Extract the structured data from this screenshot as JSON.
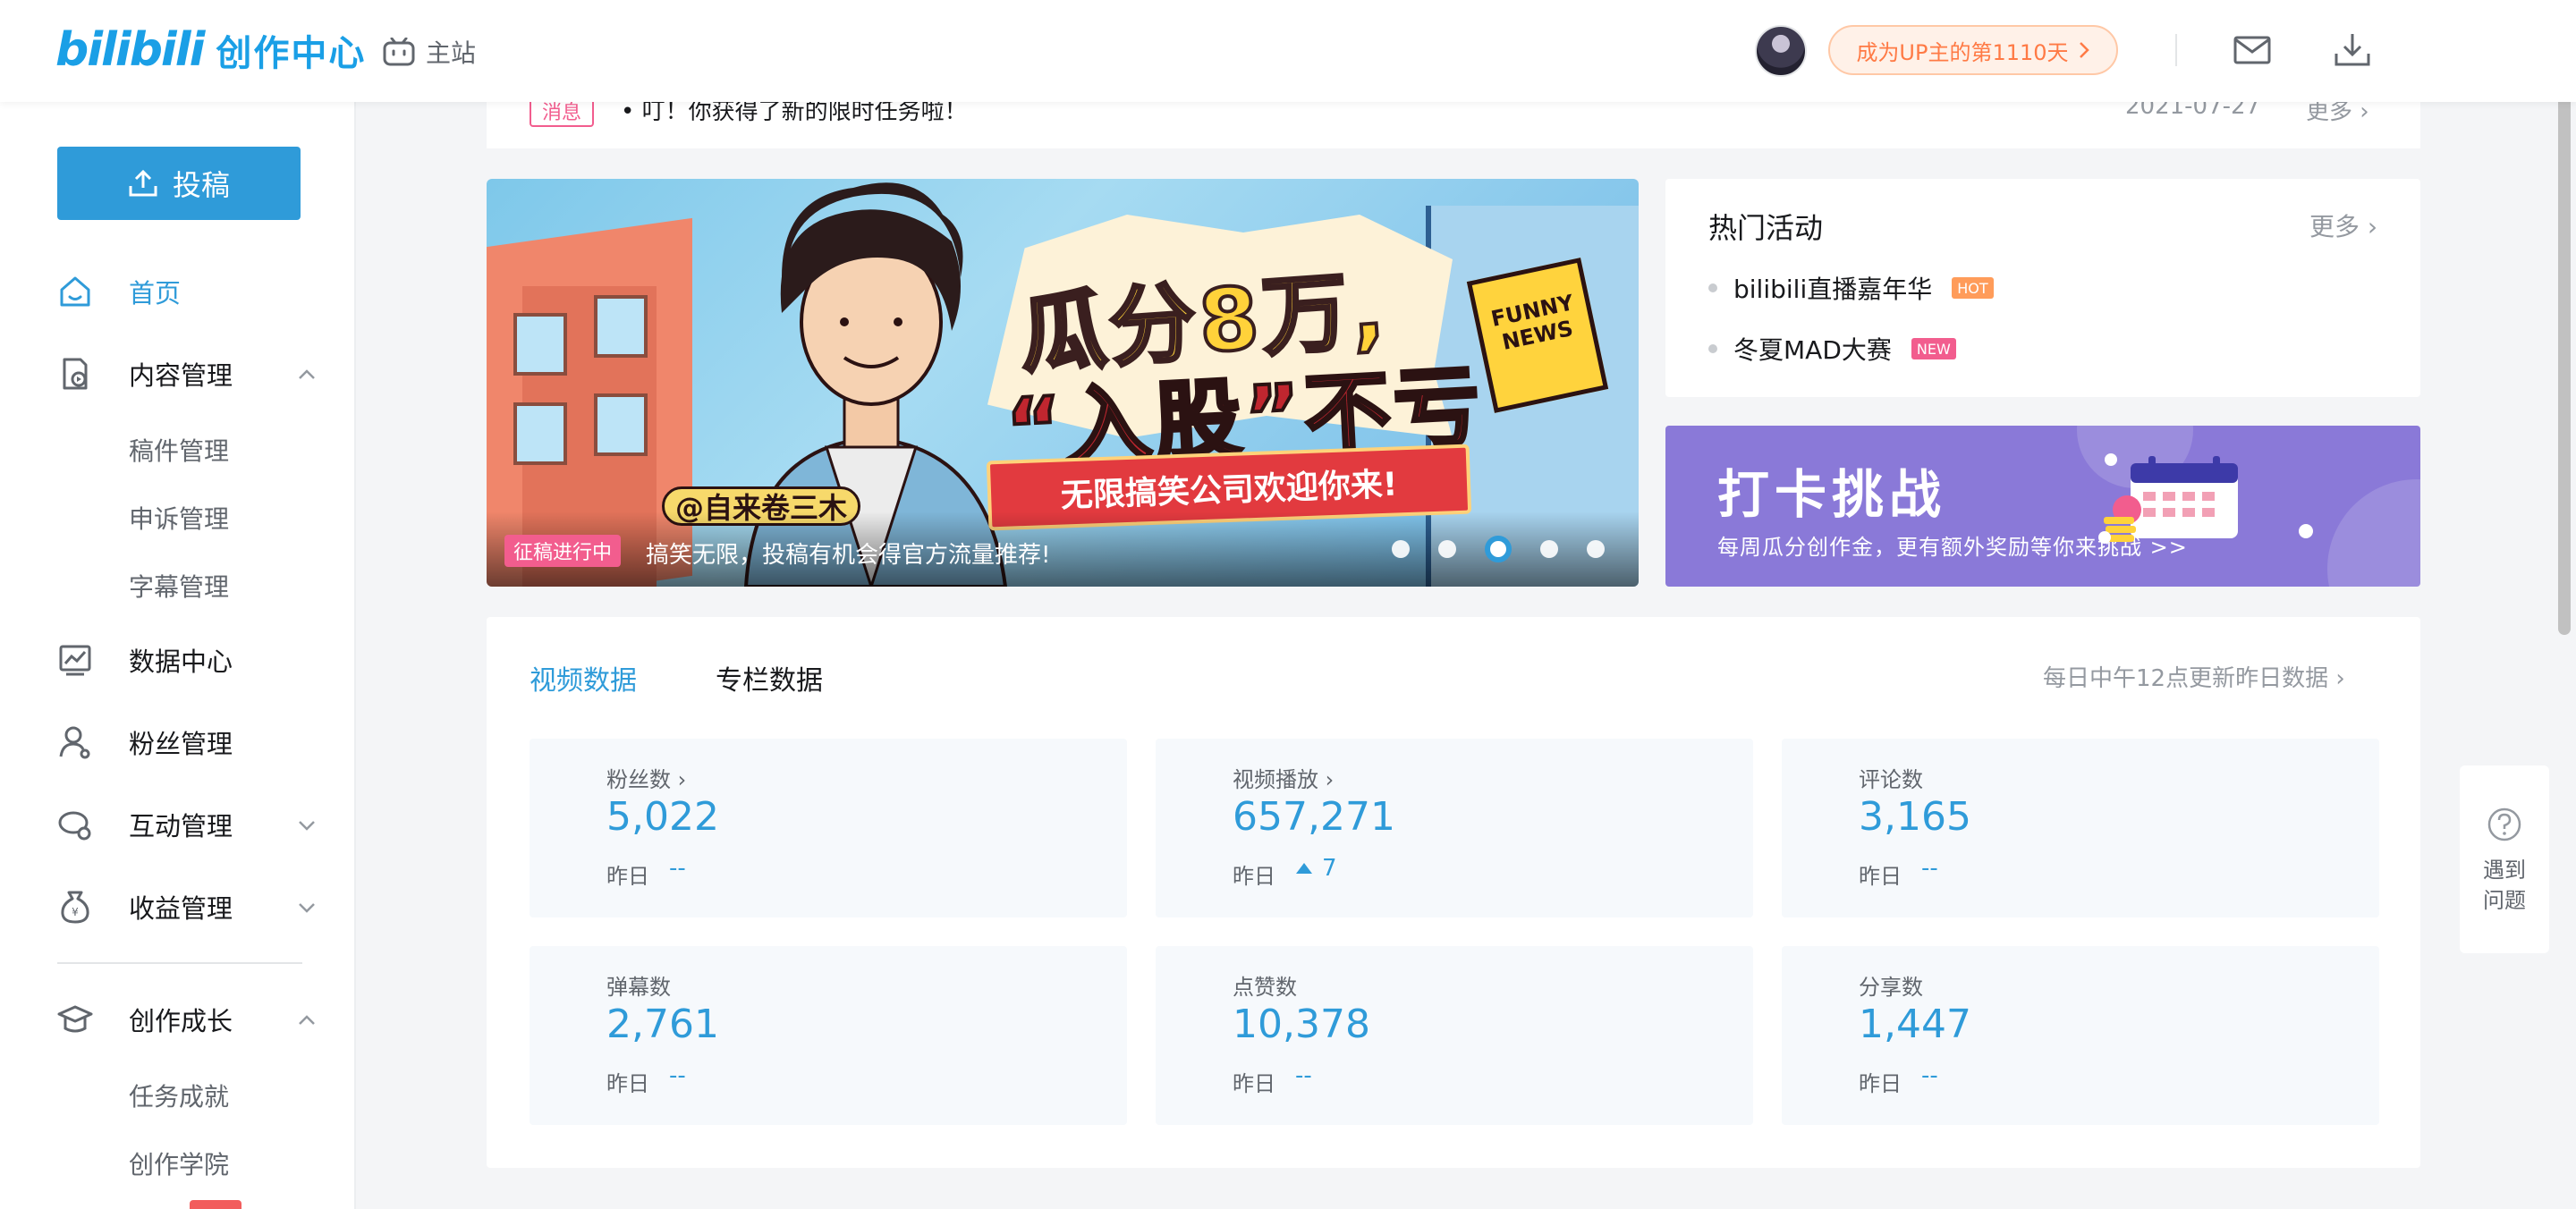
{
  "header": {
    "logo_mark": "bilibili",
    "logo_text": "创作中心",
    "main_site_label": "主站",
    "up_badge": "成为UP主的第1110天",
    "icons": [
      "tv-icon",
      "mail-icon",
      "download-icon"
    ]
  },
  "sidebar": {
    "upload_label": "投稿",
    "items": [
      {
        "label": "首页",
        "icon": "home-icon",
        "active": true
      },
      {
        "label": "内容管理",
        "icon": "content-icon",
        "expanded": true
      },
      {
        "label": "数据中心",
        "icon": "data-icon"
      },
      {
        "label": "粉丝管理",
        "icon": "fans-icon"
      },
      {
        "label": "互动管理",
        "icon": "interact-icon",
        "expanded": false
      },
      {
        "label": "收益管理",
        "icon": "income-icon",
        "expanded": false
      },
      {
        "label": "创作成长",
        "icon": "growth-icon",
        "expanded": true
      }
    ],
    "content_sub": [
      "稿件管理",
      "申诉管理",
      "字幕管理"
    ],
    "growth_sub": [
      "任务成就",
      "创作学院"
    ]
  },
  "notice": {
    "tag": "消息",
    "text": "叮！你获得了新的限时任务啦！",
    "date": "2021-07-27",
    "more": "更多"
  },
  "banner": {
    "title_line1": "瓜分8万,",
    "title_line2": "“入股”不亏",
    "ribbon": "无限搞笑公司欢迎你来!",
    "handle": "@自来卷三木",
    "sign": "FUNNY NEWS",
    "tag": "征稿进行中",
    "caption": "搞笑无限，投稿有机会得官方流量推荐!",
    "dot_count": 5,
    "active_dot": 2
  },
  "hot": {
    "title": "热门活动",
    "more": "更多",
    "items": [
      {
        "label": "bilibili直播嘉年华",
        "badge": "HOT",
        "badge_color": "#ff9c5a"
      },
      {
        "label": "冬夏MAD大赛",
        "badge": "NEW",
        "badge_color": "#f25d8e"
      }
    ]
  },
  "challenge": {
    "title": "打卡挑战",
    "subtitle": "每周瓜分创作金，更有额外奖励等你来挑战 >>"
  },
  "data_panel": {
    "tabs": [
      "视频数据",
      "专栏数据"
    ],
    "update_note": "每日中午12点更新昨日数据",
    "yesterday_label": "昨日",
    "cards": [
      {
        "label": "粉丝数",
        "has_link": true,
        "value": "5,022",
        "yesterday": "--",
        "trend": ""
      },
      {
        "label": "视频播放",
        "has_link": true,
        "value": "657,271",
        "yesterday": "7",
        "trend": "up"
      },
      {
        "label": "评论数",
        "has_link": false,
        "value": "3,165",
        "yesterday": "--",
        "trend": ""
      },
      {
        "label": "弹幕数",
        "has_link": false,
        "value": "2,761",
        "yesterday": "--",
        "trend": ""
      },
      {
        "label": "点赞数",
        "has_link": false,
        "value": "10,378",
        "yesterday": "--",
        "trend": ""
      },
      {
        "label": "分享数",
        "has_link": false,
        "value": "1,447",
        "yesterday": "--",
        "trend": ""
      }
    ]
  },
  "help": {
    "label": "遇到问题"
  },
  "colors": {
    "accent": "#2f9bd9",
    "pink": "#f25d8e",
    "orange": "#ff7a45",
    "challenge_bg": "#8a79d8"
  }
}
